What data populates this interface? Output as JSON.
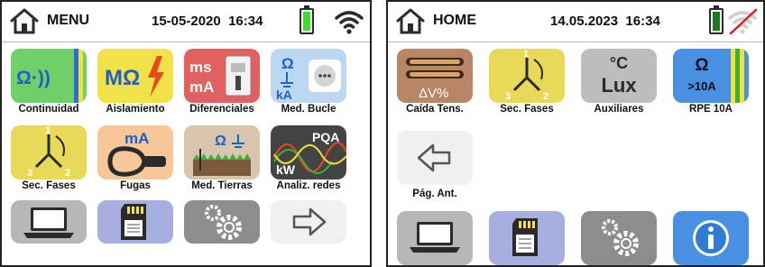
{
  "left": {
    "title": "MENU",
    "date": "15-05-2020",
    "time": "16:34",
    "tiles": [
      {
        "id": "continuidad",
        "label": "Continuidad",
        "symbol": "Ω·))",
        "color": "#6fd06a"
      },
      {
        "id": "aislamiento",
        "label": "Aislamiento",
        "symbol": "MΩ",
        "color": "#f2e24a"
      },
      {
        "id": "diferenciales",
        "label": "Diferenciales",
        "symbol_top": "ms",
        "symbol_bottom": "mA",
        "color": "#e2605f"
      },
      {
        "id": "med-bucle",
        "label": "Med. Bucle",
        "symbol_top": "Ω",
        "symbol_bottom": "kA",
        "color": "#bcd8f0"
      },
      {
        "id": "sec-fases",
        "label": "Sec. Fases",
        "phase_1": "1",
        "phase_2": "2",
        "phase_3": "3",
        "color": "#e8d957"
      },
      {
        "id": "fugas",
        "label": "Fugas",
        "symbol": "mA",
        "color": "#f7c79a"
      },
      {
        "id": "med-tierras",
        "label": "Med. Tierras",
        "symbol": "Ω",
        "color": "#d9c4ae"
      },
      {
        "id": "analiz-redes",
        "label": "Analiz. redes",
        "symbol_top": "PQA",
        "symbol_bottom": "kW",
        "color": "#444444"
      }
    ],
    "bottom_tiles": [
      {
        "id": "laptop",
        "icon": "laptop-icon",
        "color": "#b7b7b7"
      },
      {
        "id": "memory",
        "icon": "sd-card-icon",
        "color": "#a7aee0"
      },
      {
        "id": "settings",
        "icon": "gear-icon",
        "color": "#8d8d8d"
      },
      {
        "id": "next",
        "icon": "arrow-right-icon",
        "color": "#f0f0f0"
      }
    ]
  },
  "right": {
    "title": "HOME",
    "date": "14.05.2023",
    "time": "16:34",
    "tiles": [
      {
        "id": "caida-tens",
        "label": "Caída Tens.",
        "symbol": "ΔV%",
        "color": "#b88565"
      },
      {
        "id": "sec-fases",
        "label": "Sec. Fases",
        "phase_1": "1",
        "phase_2": "2",
        "phase_3": "3",
        "color": "#e8d957"
      },
      {
        "id": "auxiliares",
        "label": "Auxiliares",
        "symbol_top": "°C",
        "symbol_bottom": "Lux",
        "color": "#bdbdbd"
      },
      {
        "id": "rpe-10a",
        "label": "RPE 10A",
        "symbol_top": "Ω",
        "symbol_bottom": ">10A",
        "color": "#4a90e2"
      },
      {
        "id": "pag-ant",
        "label": "Pág. Ant.",
        "color": "#f0f0f0"
      }
    ],
    "bottom_tiles": [
      {
        "id": "laptop",
        "icon": "laptop-icon",
        "color": "#b7b7b7"
      },
      {
        "id": "memory",
        "icon": "sd-card-icon",
        "color": "#a7aee0"
      },
      {
        "id": "settings",
        "icon": "gear-icon",
        "color": "#8d8d8d"
      },
      {
        "id": "info",
        "icon": "info-icon",
        "color": "#4a90e2"
      }
    ]
  }
}
